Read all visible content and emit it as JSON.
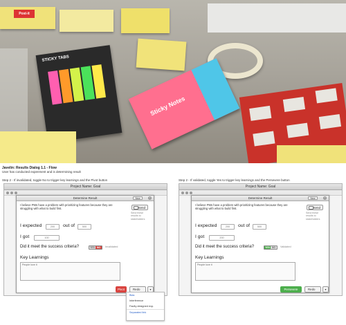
{
  "header": {
    "title": "Javelin: Results Dialog 1.1 - Flow",
    "subtitle": "User has conducted experiment and is determining result"
  },
  "photo": {
    "label_post_it": "Post-it",
    "label_sticky_tabs": "STICKY TABS",
    "label_sticky_notes": "Sticky Notes"
  },
  "panels": [
    {
      "step": "Step 2 - If invalidated, toggle No to trigger key learnings and the Pivot button",
      "project": "Project Name: Goal",
      "dialog_title": "Determine Result",
      "new_label": "New",
      "belief": "I believe PMs have a problem with prioritizing features because they are struggling with what to build first.",
      "send": "Send",
      "send_note": "Send these results to stakeholders",
      "expected_label": "I expected",
      "expected_value": "200",
      "out_of": "out of",
      "total_value": "500",
      "got_label": "I got",
      "got_value": "100",
      "question": "Did it meet the success criteria?",
      "yes": "YES",
      "no": "NO",
      "toggle_state": "no",
      "status": "Invalidated",
      "key_learnings": "Key Learnings",
      "learnings_text": "People love it",
      "primary_button": "Pivot",
      "primary_color": "#d9443f",
      "redo": "Redo",
      "dropdown_icon": "chevron-down-icon"
    },
    {
      "step": "Step 2 - If validated, toggle Yes to trigger key learnings and the Persevere button",
      "project": "Project Name: Goal",
      "dialog_title": "Determine Result",
      "new_label": "New",
      "belief": "I believe PMs have a problem with prioritizing features because they are struggling with what to build first.",
      "send": "Send",
      "send_note": "Send these results to stakeholders",
      "expected_label": "I expected",
      "expected_value": "200",
      "out_of": "out of",
      "total_value": "500",
      "got_label": "I got",
      "got_value": "200",
      "question": "Did it meet the success criteria?",
      "yes": "YES",
      "no": "NO",
      "toggle_state": "yes",
      "status": "Validated",
      "key_learnings": "Key Learnings",
      "learnings_text": "People love it",
      "primary_button": "Persevere",
      "primary_color": "#4cae4c",
      "redo": "Redo",
      "dropdown_icon": "chevron-down-icon"
    }
  ],
  "redo_menu": {
    "items": [
      "Bias",
      "Interference",
      "Faulty designed exp."
    ],
    "link": "Separated link"
  },
  "colors": {
    "accent_red": "#d9443f",
    "accent_green": "#4cae4c",
    "link_blue": "#2a62c9"
  }
}
